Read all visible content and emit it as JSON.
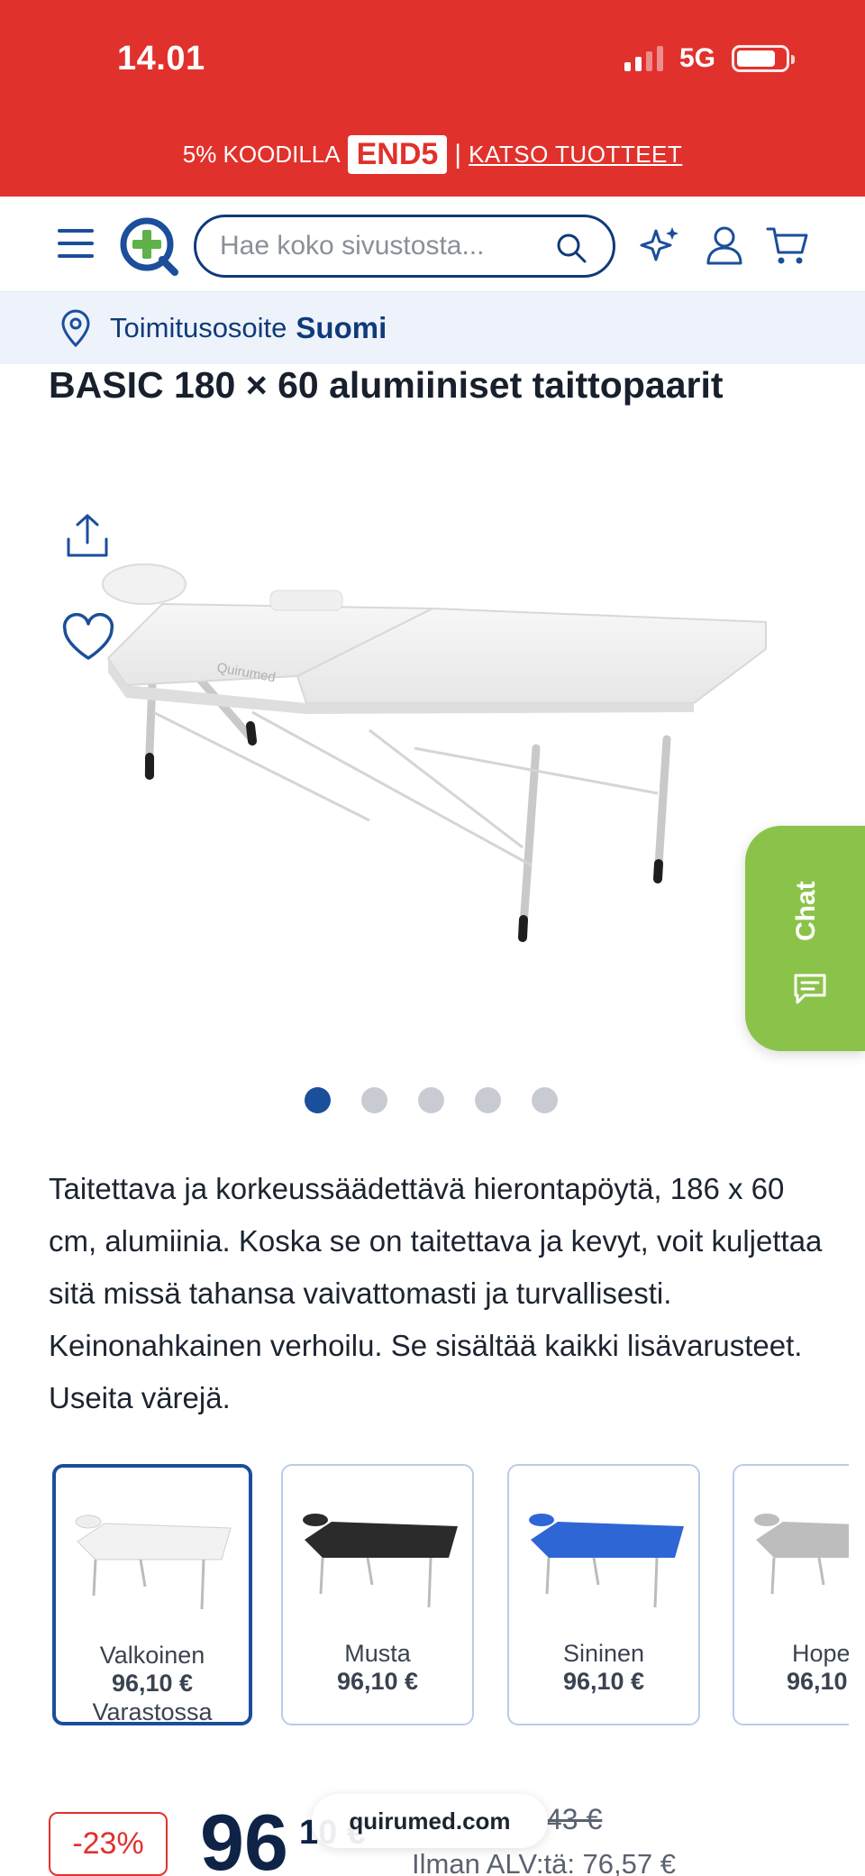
{
  "status_bar": {
    "time": "14.01",
    "network": "5G"
  },
  "promo": {
    "prefix": "5% KOODILLA",
    "code": "END5",
    "separator": "|",
    "link": "KATSO TUOTTEET"
  },
  "header": {
    "search_placeholder": "Hae koko sivustosta...",
    "icons": [
      "menu-icon",
      "logo",
      "search-icon",
      "sparkle-icon",
      "user-icon",
      "cart-icon"
    ]
  },
  "delivery": {
    "label": "Toimitusosoite",
    "country": "Suomi"
  },
  "product": {
    "title": "BASIC 180 × 60 alumiiniset taittopaarit",
    "description": "Taitettava ja korkeussäädettävä hierontapöytä, 186 x 60 cm, alumiinia. Koska se on taitettava ja kevyt, voit kuljettaa sitä missä tahansa vaivattomasti ja turvallisesti. Keinonahkainen verhoilu. Se sisältää kaikki lisävarusteet. Useita värejä.",
    "image_count": 5,
    "active_image": 1
  },
  "chat": {
    "label": "Chat"
  },
  "variants": [
    {
      "name": "Valkoinen",
      "price": "96,10 €",
      "stock": "Varastossa",
      "color": "#f2f2f2"
    },
    {
      "name": "Musta",
      "price": "96,10 €",
      "stock": "",
      "color": "#2b2b2b"
    },
    {
      "name": "Sininen",
      "price": "96,10 €",
      "stock": "",
      "color": "#2f66d6"
    },
    {
      "name": "Hope",
      "price": "96,10",
      "stock": "",
      "color": "#bdbdbd"
    }
  ],
  "pricing": {
    "discount": "-23%",
    "price_main": "96",
    "price_cents": "10 €",
    "old_price": "43 €",
    "net_price": "Ilman ALV:tä: 76,57 €"
  },
  "url_pill": "quirumed.com",
  "colors": {
    "brand_red": "#e1312c",
    "brand_blue": "#1b4e9b",
    "chat_green": "#8bc34a"
  }
}
